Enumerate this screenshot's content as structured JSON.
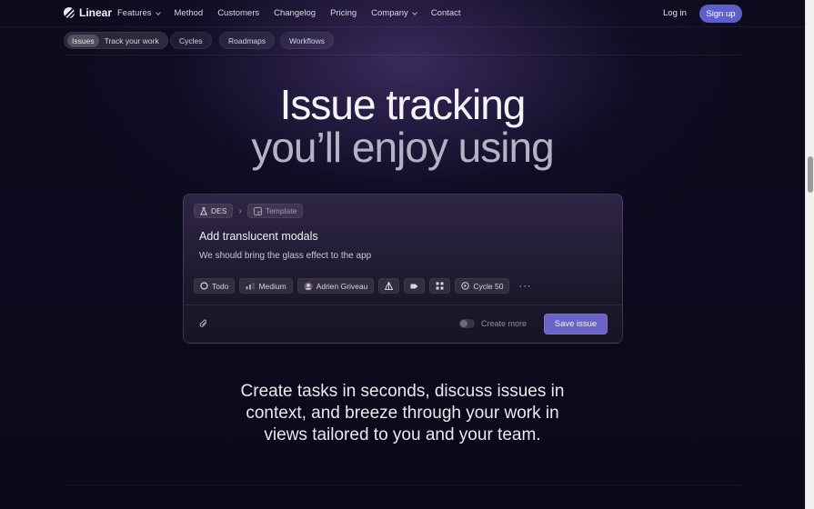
{
  "nav": {
    "brand": "Linear",
    "links": [
      {
        "label": "Features",
        "dropdown": true
      },
      {
        "label": "Method",
        "dropdown": false
      },
      {
        "label": "Customers",
        "dropdown": false
      },
      {
        "label": "Changelog",
        "dropdown": false
      },
      {
        "label": "Pricing",
        "dropdown": false
      },
      {
        "label": "Company",
        "dropdown": true
      },
      {
        "label": "Contact",
        "dropdown": false
      }
    ],
    "login": "Log in",
    "signup": "Sign up"
  },
  "subnav": {
    "active_tag": "Issues",
    "active_label": "Track your work",
    "items": [
      "Cycles",
      "Roadmaps",
      "Workflows"
    ]
  },
  "hero": {
    "line1": "Issue tracking",
    "line2": "you’ll enjoy using"
  },
  "card": {
    "team": "DES",
    "template": "Template",
    "title": "Add translucent modals",
    "description": "We should bring the glass effect to the app",
    "props": {
      "status": "Todo",
      "priority": "Medium",
      "assignee": "Adrien Griveau",
      "cycle": "Cycle 50"
    },
    "more": "···",
    "create_more": "Create more",
    "save": "Save issue"
  },
  "tagline": "Create tasks in seconds, discuss issues in context, and breeze through your work in views tailored to you and your team.",
  "colors": {
    "accent": "#5e5fc9",
    "save_button": "#6a63c8",
    "background": "#0c0a1e"
  }
}
